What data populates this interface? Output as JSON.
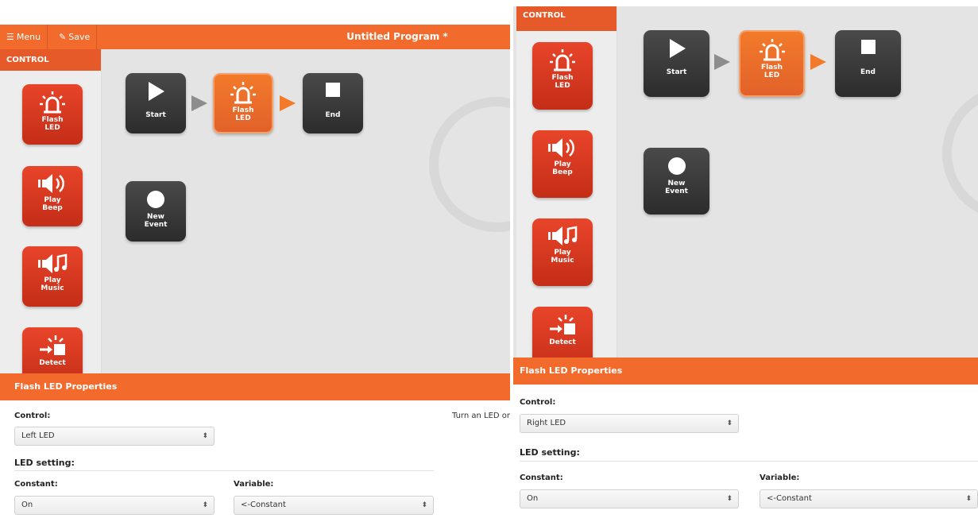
{
  "toolbar": {
    "menu_label": "Menu",
    "save_label": "Save",
    "program_title": "Untitled Program *"
  },
  "palette": {
    "header": "CONTROL",
    "items": [
      {
        "line1": "Flash",
        "line2": "LED",
        "icon": "flash-led-icon"
      },
      {
        "line1": "Play",
        "line2": "Beep",
        "icon": "speaker-beep-icon"
      },
      {
        "line1": "Play",
        "line2": "Music",
        "icon": "speaker-music-icon"
      },
      {
        "line1": "Detect",
        "line2": "",
        "icon": "detect-icon"
      }
    ]
  },
  "program": {
    "start": {
      "label": "Start"
    },
    "flash": {
      "line1": "Flash",
      "line2": "LED"
    },
    "end": {
      "label": "End"
    },
    "event": {
      "line1": "New",
      "line2": "Event"
    }
  },
  "left_props": {
    "title": "Flash LED Properties",
    "control_label": "Control:",
    "control_value": "Left LED",
    "led_setting_title": "LED setting:",
    "constant_label": "Constant:",
    "constant_value": "On",
    "variable_label": "Variable:",
    "variable_value": "<-Constant",
    "help_text": "Turn an LED on"
  },
  "right_props": {
    "title": "Flash LED Properties",
    "control_label": "Control:",
    "control_value": "Right LED",
    "led_setting_title": "LED setting:",
    "constant_label": "Constant:",
    "constant_value": "On",
    "variable_label": "Variable:",
    "variable_value": "<-Constant"
  },
  "colors": {
    "accent": "#f26b2c",
    "tile_red": "#d63a1f",
    "tile_dark": "#333333",
    "canvas": "#e4e4e4"
  }
}
